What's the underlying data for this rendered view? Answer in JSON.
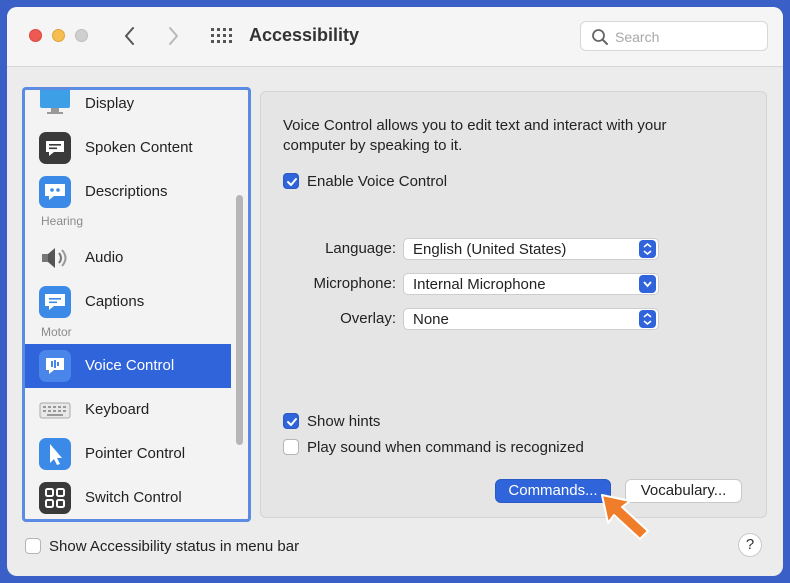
{
  "window": {
    "title": "Accessibility",
    "search_placeholder": "Search"
  },
  "sidebar": {
    "items": [
      {
        "label": "Display",
        "icon": "display-icon"
      },
      {
        "label": "Spoken Content",
        "icon": "speech-bubble-icon"
      },
      {
        "label": "Descriptions",
        "icon": "quote-bubble-icon"
      },
      {
        "label": "Audio",
        "icon": "speaker-icon"
      },
      {
        "label": "Captions",
        "icon": "caption-bubble-icon"
      },
      {
        "label": "Voice Control",
        "icon": "voice-control-icon",
        "selected": true
      },
      {
        "label": "Keyboard",
        "icon": "keyboard-icon"
      },
      {
        "label": "Pointer Control",
        "icon": "pointer-icon"
      },
      {
        "label": "Switch Control",
        "icon": "switch-grid-icon"
      }
    ],
    "sections": {
      "hearing": "Hearing",
      "motor": "Motor"
    }
  },
  "panel": {
    "description": "Voice Control allows you to edit text and interact with your computer by speaking to it.",
    "enable_label": "Enable Voice Control",
    "enable_checked": true,
    "language_label": "Language:",
    "language_value": "English (United States)",
    "microphone_label": "Microphone:",
    "microphone_value": "Internal Microphone",
    "overlay_label": "Overlay:",
    "overlay_value": "None",
    "show_hints_label": "Show hints",
    "show_hints_checked": true,
    "play_sound_label": "Play sound when command is recognized",
    "play_sound_checked": false,
    "commands_button": "Commands...",
    "vocabulary_button": "Vocabulary..."
  },
  "footer": {
    "status_label": "Show Accessibility status in menu bar",
    "status_checked": false,
    "help_label": "?"
  },
  "colors": {
    "accent": "#2f64db",
    "sidebar_border": "#5b8be3",
    "pointer_arrow": "#f07d2a"
  }
}
